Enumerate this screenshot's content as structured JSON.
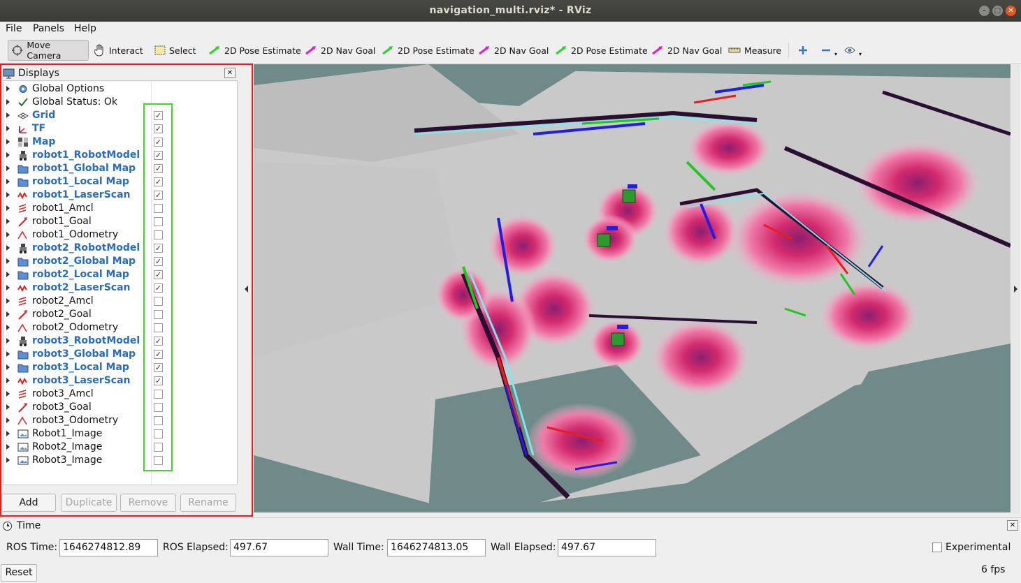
{
  "window": {
    "title": "navigation_multi.rviz* - RViz"
  },
  "menu": {
    "file": "File",
    "panels": "Panels",
    "help": "Help"
  },
  "toolbar": {
    "tools": [
      {
        "label": "Move Camera",
        "icon": "move-camera-icon",
        "active": true
      },
      {
        "label": "Interact",
        "icon": "hand-icon"
      },
      {
        "label": "Select",
        "icon": "select-box-icon"
      },
      {
        "label": "2D Pose Estimate",
        "icon": "green-arrow-icon"
      },
      {
        "label": "2D Nav Goal",
        "icon": "magenta-arrow-icon"
      },
      {
        "label": "2D Pose Estimate",
        "icon": "green-arrow-icon"
      },
      {
        "label": "2D Nav Goal",
        "icon": "magenta-arrow-icon"
      },
      {
        "label": "2D Pose Estimate",
        "icon": "green-arrow-icon"
      },
      {
        "label": "2D Nav Goal",
        "icon": "magenta-arrow-icon"
      },
      {
        "label": "Measure",
        "icon": "ruler-icon"
      }
    ]
  },
  "displays": {
    "title": "Displays",
    "items": [
      {
        "name": "Global Options",
        "icon": "gear-icon",
        "bold": false,
        "checkbox": false
      },
      {
        "name": "Global Status: Ok",
        "icon": "checkmark-icon",
        "bold": false,
        "checkbox": false
      },
      {
        "name": "Grid",
        "icon": "grid-icon",
        "bold": true,
        "checkbox": true,
        "checked": true
      },
      {
        "name": "TF",
        "icon": "tf-icon",
        "bold": true,
        "checkbox": true,
        "checked": true
      },
      {
        "name": "Map",
        "icon": "map-icon",
        "bold": true,
        "checkbox": true,
        "checked": true
      },
      {
        "name": "robot1_RobotModel",
        "icon": "robot-model-icon",
        "bold": true,
        "checkbox": true,
        "checked": true
      },
      {
        "name": "robot1_Global Map",
        "icon": "folder-icon",
        "bold": true,
        "checkbox": true,
        "checked": true
      },
      {
        "name": "robot1_Local Map",
        "icon": "folder-icon",
        "bold": true,
        "checkbox": true,
        "checked": true
      },
      {
        "name": "robot1_LaserScan",
        "icon": "laserscan-icon",
        "bold": true,
        "checkbox": true,
        "checked": true
      },
      {
        "name": "robot1_Amcl",
        "icon": "pose-array-icon",
        "bold": false,
        "checkbox": true,
        "checked": false
      },
      {
        "name": "robot1_Goal",
        "icon": "pose-icon",
        "bold": false,
        "checkbox": true,
        "checked": false
      },
      {
        "name": "robot1_Odometry",
        "icon": "odometry-icon",
        "bold": false,
        "checkbox": true,
        "checked": false
      },
      {
        "name": "robot2_RobotModel",
        "icon": "robot-model-icon",
        "bold": true,
        "checkbox": true,
        "checked": true
      },
      {
        "name": "robot2_Global Map",
        "icon": "folder-icon",
        "bold": true,
        "checkbox": true,
        "checked": true
      },
      {
        "name": "robot2_Local Map",
        "icon": "folder-icon",
        "bold": true,
        "checkbox": true,
        "checked": true
      },
      {
        "name": "robot2_LaserScan",
        "icon": "laserscan-icon",
        "bold": true,
        "checkbox": true,
        "checked": true
      },
      {
        "name": "robot2_Amcl",
        "icon": "pose-array-icon",
        "bold": false,
        "checkbox": true,
        "checked": false
      },
      {
        "name": "robot2_Goal",
        "icon": "pose-icon",
        "bold": false,
        "checkbox": true,
        "checked": false
      },
      {
        "name": "robot2_Odometry",
        "icon": "odometry-icon",
        "bold": false,
        "checkbox": true,
        "checked": false
      },
      {
        "name": "robot3_RobotModel",
        "icon": "robot-model-icon",
        "bold": true,
        "checkbox": true,
        "checked": true
      },
      {
        "name": "robot3_Global Map",
        "icon": "folder-icon",
        "bold": true,
        "checkbox": true,
        "checked": true
      },
      {
        "name": "robot3_Local Map",
        "icon": "folder-icon",
        "bold": true,
        "checkbox": true,
        "checked": true
      },
      {
        "name": "robot3_LaserScan",
        "icon": "laserscan-icon",
        "bold": true,
        "checkbox": true,
        "checked": true
      },
      {
        "name": "robot3_Amcl",
        "icon": "pose-array-icon",
        "bold": false,
        "checkbox": true,
        "checked": false
      },
      {
        "name": "robot3_Goal",
        "icon": "pose-icon",
        "bold": false,
        "checkbox": true,
        "checked": false
      },
      {
        "name": "robot3_Odometry",
        "icon": "odometry-icon",
        "bold": false,
        "checkbox": true,
        "checked": false
      },
      {
        "name": "Robot1_Image",
        "icon": "image-icon",
        "bold": false,
        "checkbox": true,
        "checked": false
      },
      {
        "name": "Robot2_Image",
        "icon": "image-icon",
        "bold": false,
        "checkbox": true,
        "checked": false
      },
      {
        "name": "Robot3_Image",
        "icon": "image-icon",
        "bold": false,
        "checkbox": true,
        "checked": false
      }
    ],
    "buttons": {
      "add": "Add",
      "duplicate": "Duplicate",
      "remove": "Remove",
      "rename": "Rename"
    }
  },
  "time": {
    "title": "Time",
    "ros_time_label": "ROS Time:",
    "ros_time": "1646274812.89",
    "ros_elapsed_label": "ROS Elapsed:",
    "ros_elapsed": "497.67",
    "wall_time_label": "Wall Time:",
    "wall_time": "1646274813.05",
    "wall_elapsed_label": "Wall Elapsed:",
    "wall_elapsed": "497.67",
    "experimental_label": "Experimental",
    "reset_label": "Reset",
    "fps": "6 fps"
  },
  "colors": {
    "highlight_red": "#e02020",
    "highlight_green": "#44d62c",
    "bold_item": "#2a6cb7",
    "map_free": "#c9c9c9",
    "map_unknown": "#6f8a88"
  }
}
